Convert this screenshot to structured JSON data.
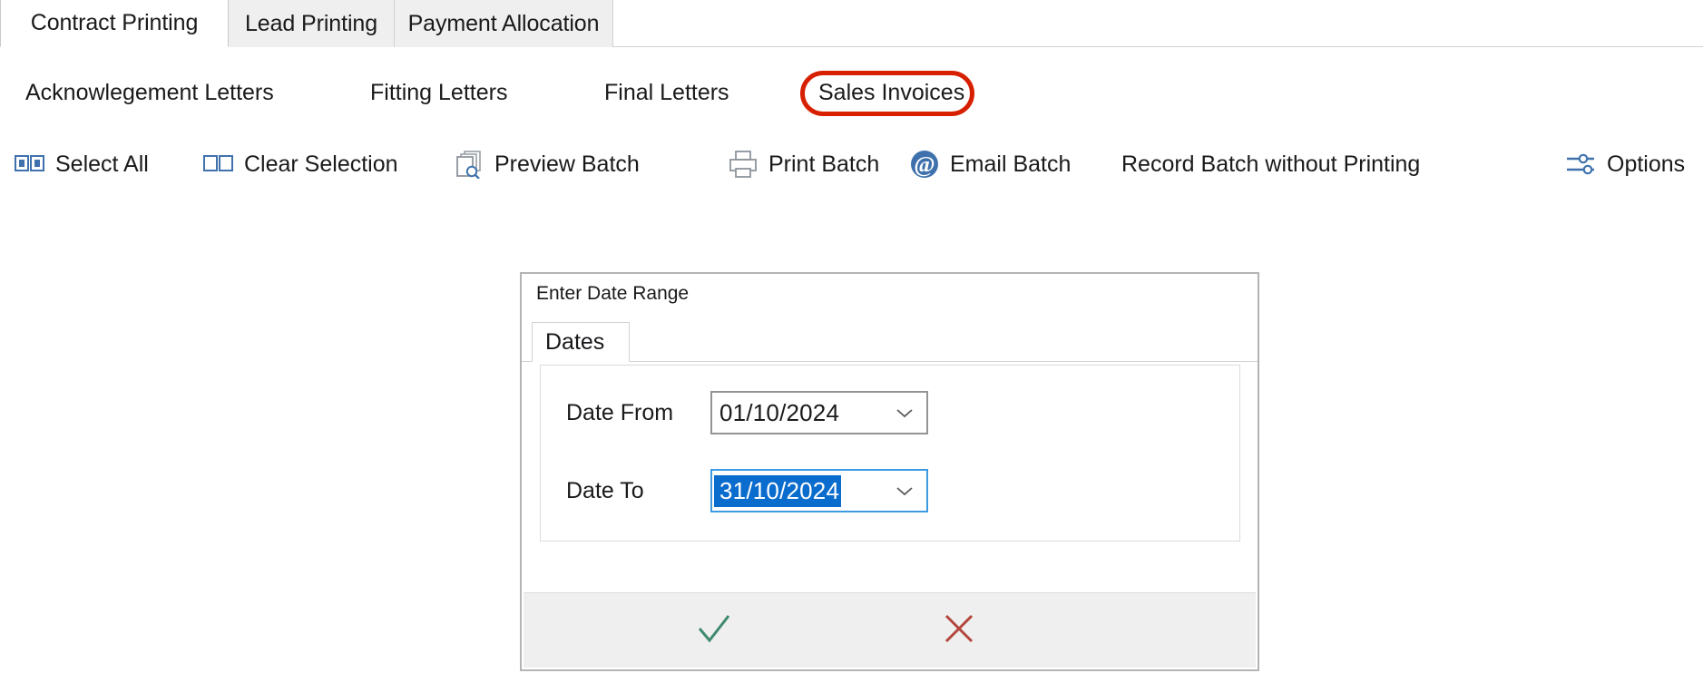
{
  "tabs": [
    {
      "label": "Contract Printing",
      "active": true
    },
    {
      "label": "Lead Printing",
      "active": false
    },
    {
      "label": "Payment Allocation",
      "active": false
    }
  ],
  "subnav": [
    {
      "label": "Acknowlegement Letters",
      "highlighted": false
    },
    {
      "label": "Fitting Letters",
      "highlighted": false
    },
    {
      "label": "Final Letters",
      "highlighted": false
    },
    {
      "label": "Sales Invoices",
      "highlighted": true
    }
  ],
  "annotation": {
    "shape": "oval",
    "color": "#d62000",
    "targets": "Sales Invoices"
  },
  "toolbar": [
    {
      "label": "Select All",
      "icon": "select-all-icon"
    },
    {
      "label": "Clear Selection",
      "icon": "clear-selection-icon"
    },
    {
      "label": "Preview Batch",
      "icon": "preview-icon"
    },
    {
      "label": "Print Batch",
      "icon": "printer-icon"
    },
    {
      "label": "Email Batch",
      "icon": "at-sign-icon"
    },
    {
      "label": "Record Batch without Printing",
      "icon": "none"
    },
    {
      "label": "Options",
      "icon": "sliders-icon"
    }
  ],
  "dialog": {
    "title": "Enter Date Range",
    "tab_label": "Dates",
    "fields": [
      {
        "label": "Date From",
        "value": "01/10/2024",
        "focused": false,
        "selected": false
      },
      {
        "label": "Date To",
        "value": "31/10/2024",
        "focused": true,
        "selected": true
      }
    ],
    "footer": {
      "ok_icon": "check-icon",
      "cancel_icon": "cross-icon",
      "ok_color": "#3f8a6e",
      "cancel_color": "#b3453c"
    }
  },
  "colors": {
    "accent_blue": "#3f72ad",
    "annotation_red": "#d62000",
    "selection_blue": "#0a6ccd",
    "tab_inactive_bg": "#efefef"
  }
}
